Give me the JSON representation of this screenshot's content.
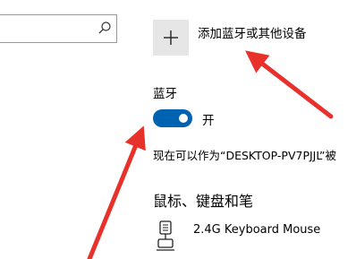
{
  "bluetooth": {
    "add_device_label": "添加蓝牙或其他设备",
    "heading": "蓝牙",
    "toggle_state": "开",
    "discoverable_text": "现在可以作为“DESKTOP-PV7PJJL”被",
    "toggle_on": true
  },
  "devices": {
    "section_title": "鼠标、键盘和笔",
    "items": [
      {
        "name": "2.4G Keyboard Mouse",
        "icon": "keyboard-mouse-icon"
      }
    ]
  },
  "colors": {
    "accent": "#0063b1",
    "annotation_arrow": "#e8312b",
    "tile_background": "#e6e6e6"
  }
}
